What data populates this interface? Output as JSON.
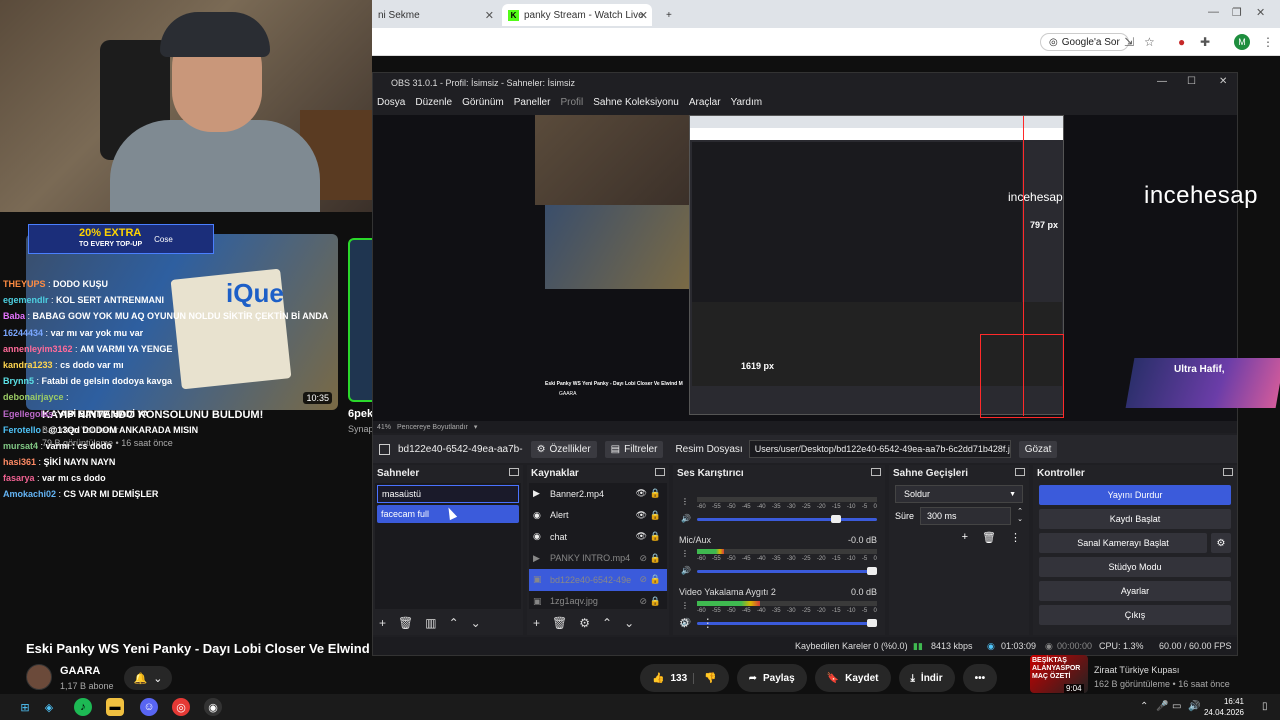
{
  "browser": {
    "tab1": "ni Sekme",
    "tab2": "panky Stream - Watch Live on K",
    "new_tab": "+",
    "google_sor": "Google'a Sor",
    "profile_initial": "M"
  },
  "stream": {
    "promo_extra": "20% EXTRA",
    "promo_sub": "TO EVERY TOP-UP",
    "promo_brand": "Cose",
    "video_duration": "10:35",
    "video_title": "KAYIP NINTENDO KONSOLUNU BULDUM!",
    "video_channel": "Baturhan Yondemir",
    "video_meta": "79 B görüntüleme • 16 saat önce",
    "next_title": "6pek",
    "next_sub1": "Synap",
    "next_sub2": "59 B"
  },
  "chat": [
    {
      "user": "THEYUPS",
      "msg": "DODO KUŞU",
      "color": "#ff8c42"
    },
    {
      "user": "egemendlr",
      "msg": "KOL SERT ANTRENMANI",
      "color": "#4dd0e1"
    },
    {
      "user": "Baba",
      "msg": "BABAG GOW YOK MU AQ OYUNUN NOLDU SİKTİR ÇEKTİN Bİ ANDA",
      "color": "#e573ff"
    },
    {
      "user": "16244434",
      "msg": "var mı var yok mu var",
      "color": "#7aa7ff"
    },
    {
      "user": "annenleyim3162",
      "msg": "AM VARMI YA YENGE",
      "color": "#ff6b9a"
    },
    {
      "user": "kandra1233",
      "msg": "cs dodo var mı",
      "color": "#ffd54f"
    },
    {
      "user": "Brynn5",
      "msg": "Fatabi de gelsin dodoya kavga",
      "color": "#5ce1e6"
    },
    {
      "user": "debonairjayce",
      "msg": "",
      "color": "#9ccc65"
    },
    {
      "user": "Egellegolas",
      "msg": "ABİ BAYMA HADİ YA",
      "color": "#ba68c8"
    },
    {
      "user": "Ferotello",
      "msg": "@13Qd DODOM ANKARADA MISIN",
      "color": "#4fc3f7"
    },
    {
      "user": "mursat4",
      "msg": "varmı : cs dodo",
      "color": "#81c784"
    },
    {
      "user": "hasi361",
      "msg": "ŞİKİ NAYN NAYN",
      "color": "#ff8a65"
    },
    {
      "user": "fasarya",
      "msg": "var mı cs dodo",
      "color": "#f06292"
    },
    {
      "user": "Amokachi02",
      "msg": "CS VAR MI DEMİŞLER",
      "color": "#64b5f6"
    }
  ],
  "youtube": {
    "title": "Eski Panky WS Yeni Panky - Dayı Lobi Closer Ve Elwind Mac",
    "channel": "GAARA",
    "subs": "1,17 B abone",
    "likes": "133",
    "share": "Paylaş",
    "save": "Kaydet",
    "download": "İndir",
    "more": "•••",
    "rec_title": "Ziraat Türkiye Kupası",
    "rec_meta": "162 B görüntüleme • 16 saat önce",
    "rec_duration": "9:04",
    "rec_overlay": "BEŞİKTAŞ ALANYASPOR MAÇ ÖZETİ"
  },
  "obs": {
    "title": "OBS 31.0.1 - Profil: İsimsiz - Sahneler: İsimsiz",
    "menu": [
      "Dosya",
      "Düzenle",
      "Görünüm",
      "Paneller",
      "Profil",
      "Sahne Koleksiyonu",
      "Araçlar",
      "Yardım"
    ],
    "preview": {
      "px_label_1": "797 px",
      "px_label_2": "1619 px",
      "incehesap": "incehesap",
      "ultra": "Ultra Hafif,",
      "pv_title": "Eski Panky WS Yeni Panky - Dayı Lobi Closer Ve Elwind M",
      "pv_channel": "GAARA"
    },
    "zoom": "41%",
    "zoom_label": "Pencereye Boyutlandır",
    "source_name": "bd122e40-6542-49ea-aa7b-",
    "properties": "Özellikler",
    "filters": "Filtreler",
    "image_file_label": "Resim Dosyası",
    "image_path": "Users/user/Desktop/bd122e40-6542-49ea-aa7b-6c2dd71b428f.jpg",
    "browse": "Gözat",
    "scenes_title": "Sahneler",
    "scenes": [
      "masaüstü",
      "facecam full"
    ],
    "sources_title": "Kaynaklar",
    "sources": [
      {
        "name": "Banner2.mp4",
        "icon": "▶",
        "hidden": false
      },
      {
        "name": "Alert",
        "icon": "◉",
        "hidden": false
      },
      {
        "name": "chat",
        "icon": "◉",
        "hidden": false
      },
      {
        "name": "PANKY INTRO.mp4",
        "icon": "▶",
        "hidden": true
      },
      {
        "name": "bd122e40-6542-49e",
        "icon": "▣",
        "hidden": true
      },
      {
        "name": "1zg1aqv.jpg",
        "icon": "▣",
        "hidden": true
      }
    ],
    "mixer_title": "Ses Karıştırıcı",
    "mixer_scale": [
      "-60",
      "-55",
      "-50",
      "-45",
      "-40",
      "-35",
      "-30",
      "-25",
      "-20",
      "-15",
      "-10",
      "-5",
      "0"
    ],
    "channels": [
      {
        "name": "",
        "db": "",
        "level": 0,
        "volume": 0.8
      },
      {
        "name": "Mic/Aux",
        "db": "-0.0 dB",
        "level": 0.15,
        "volume": 1.0
      },
      {
        "name": "Video Yakalama Aygıtı 2",
        "db": "0.0 dB",
        "level": 0.35,
        "volume": 1.0
      }
    ],
    "transitions_title": "Sahne Geçişleri",
    "transition": "Soldur",
    "duration_label": "Süre",
    "duration": "300 ms",
    "controls_title": "Kontroller",
    "controls": {
      "stop_stream": "Yayını Durdur",
      "start_record": "Kaydı Başlat",
      "virtual_cam": "Sanal Kamerayı Başlat",
      "studio": "Stüdyo Modu",
      "settings": "Ayarlar",
      "exit": "Çıkış"
    },
    "status": {
      "dropped": "Kaybedilen Kareler 0 (%0.0)",
      "bitrate": "8413 kbps",
      "live_time": "01:03:09",
      "rec_time": "00:00:00",
      "cpu": "CPU: 1.3%",
      "fps": "60.00 / 60.00 FPS"
    }
  },
  "taskbar": {
    "time": "16:41",
    "date": "24.04.2026"
  }
}
